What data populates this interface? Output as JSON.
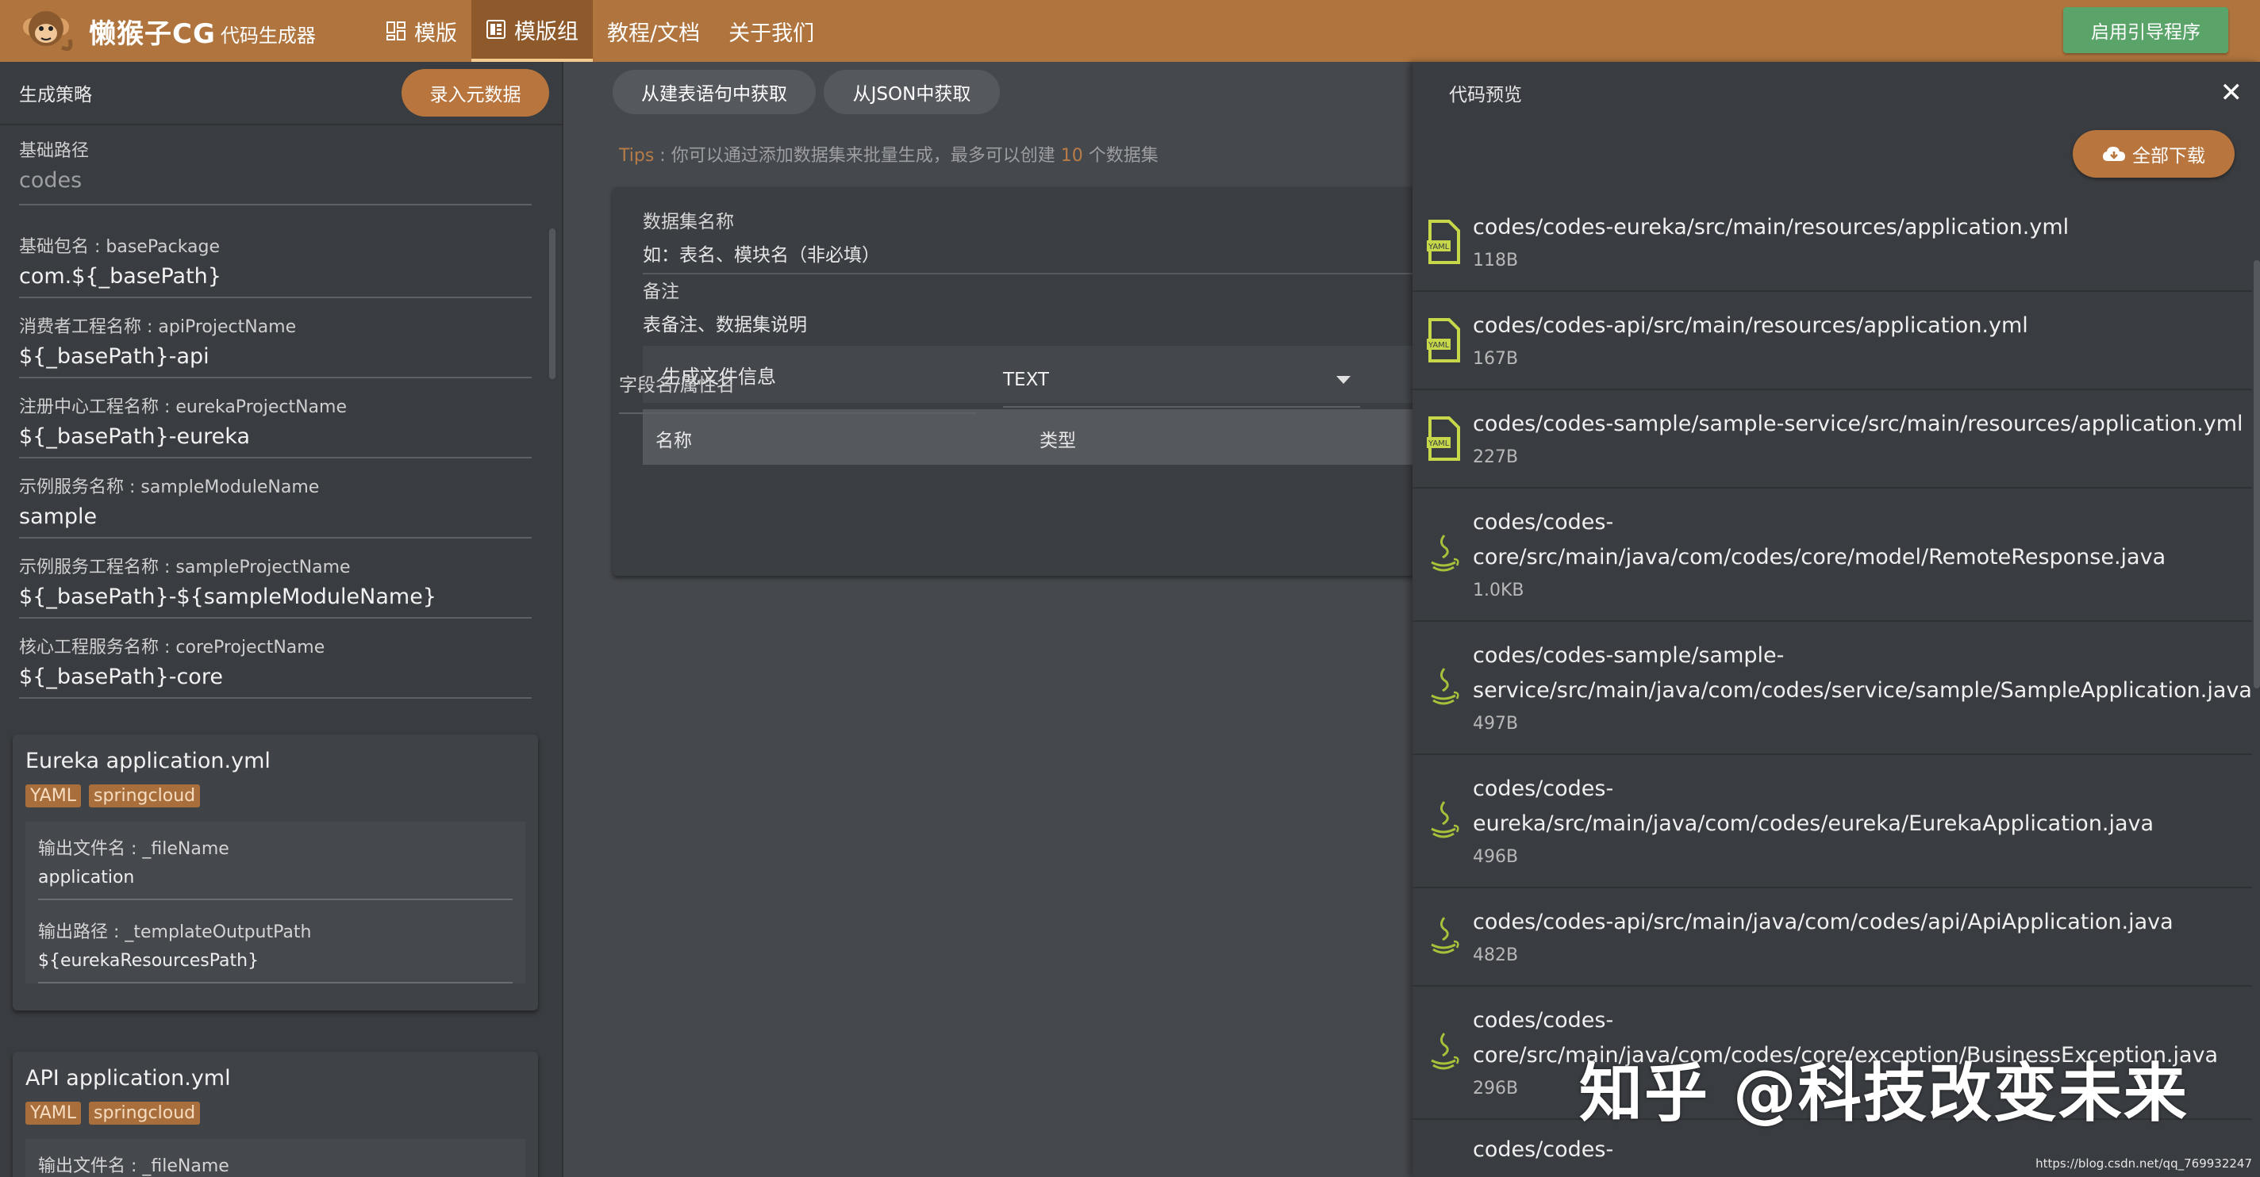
{
  "topbar": {
    "brand": "懒猴子CG",
    "brand_sub": "代码生成器",
    "nav": [
      {
        "label": "模版",
        "icon": "grid-icon"
      },
      {
        "label": "模版组",
        "icon": "template-group-icon"
      },
      {
        "label": "教程/文档"
      },
      {
        "label": "关于我们"
      }
    ],
    "guide_button": "启用引导程序"
  },
  "left": {
    "title": "生成策略",
    "meta_button": "录入元数据",
    "base_path": {
      "label": "基础路径",
      "placeholder": "codes"
    },
    "fields": [
      {
        "label": "基础包名 : basePackage",
        "value": "com.${_basePath}"
      },
      {
        "label": "消费者工程名称 : apiProjectName",
        "value": "${_basePath}-api"
      },
      {
        "label": "注册中心工程名称 : eurekaProjectName",
        "value": "${_basePath}-eureka"
      },
      {
        "label": "示例服务名称 : sampleModuleName",
        "value": "sample"
      },
      {
        "label": "示例服务工程名称 : sampleProjectName",
        "value": "${_basePath}-${sampleModuleName}"
      },
      {
        "label": "核心工程服务名称 : coreProjectName",
        "value": "${_basePath}-core"
      }
    ],
    "cards": [
      {
        "title": "Eureka application.yml",
        "tags": [
          "YAML",
          "springcloud"
        ],
        "fields": [
          {
            "label": "输出文件名 : _fileName",
            "value": "application"
          },
          {
            "label": "输出路径 : _templateOutputPath",
            "value": "${eurekaResourcesPath}"
          }
        ]
      },
      {
        "title": "API application.yml",
        "tags": [
          "YAML",
          "springcloud"
        ],
        "fields": [
          {
            "label": "输出文件名 : _fileName",
            "value": ""
          }
        ]
      }
    ]
  },
  "middle": {
    "buttons": [
      "从建表语句中获取",
      "从JSON中获取"
    ],
    "tips": {
      "prefix": "Tips",
      "text1": " : 你可以通过添加数据集来批量生成，最多可以创建 ",
      "count": "10",
      "text2": " 个数据集"
    },
    "dataset": {
      "name_label": "数据集名称",
      "name_placeholder": "如：表名、模块名（非必填）",
      "remark_label": "备注",
      "remark_placeholder": "表备注、数据集说明",
      "gen_info": "生成文件信息",
      "col_name": "名称",
      "col_type": "类型",
      "row_name_placeholder": "字段名/属性名",
      "row_type": "TEXT"
    }
  },
  "right": {
    "title": "代码预览",
    "download_button": "全部下载",
    "files": [
      {
        "path": "codes/codes-eureka/src/main/resources/application.yml",
        "size": "118B",
        "kind": "yaml-file-icon"
      },
      {
        "path": "codes/codes-api/src/main/resources/application.yml",
        "size": "167B",
        "kind": "yaml-file-icon"
      },
      {
        "path": "codes/codes-sample/sample-service/src/main/resources/application.yml",
        "size": "227B",
        "kind": "yaml-file-icon"
      },
      {
        "path": "codes/codes-\ncore/src/main/java/com/codes/core/model/RemoteResponse.java",
        "size": "1.0KB",
        "kind": "java-icon"
      },
      {
        "path": "codes/codes-sample/sample-\nservice/src/main/java/com/codes/service/sample/SampleApplication.java",
        "size": "497B",
        "kind": "java-icon"
      },
      {
        "path": "codes/codes-\neureka/src/main/java/com/codes/eureka/EurekaApplication.java",
        "size": "496B",
        "kind": "java-icon"
      },
      {
        "path": "codes/codes-api/src/main/java/com/codes/api/ApiApplication.java",
        "size": "482B",
        "kind": "java-icon"
      },
      {
        "path": "codes/codes-\ncore/src/main/java/com/codes/core/exception/BusinessException.java",
        "size": "296B",
        "kind": "java-icon"
      },
      {
        "path": "codes/codes-",
        "size": "",
        "kind": "java-icon"
      }
    ]
  },
  "watermark": "知乎 @科技改变未来",
  "credit": "https://blog.csdn.net/qq_769932247",
  "colors": {
    "topbar": "#b0753e",
    "accent": "#b8763e",
    "guide": "#5aa46a",
    "tips": "#b77c47"
  }
}
